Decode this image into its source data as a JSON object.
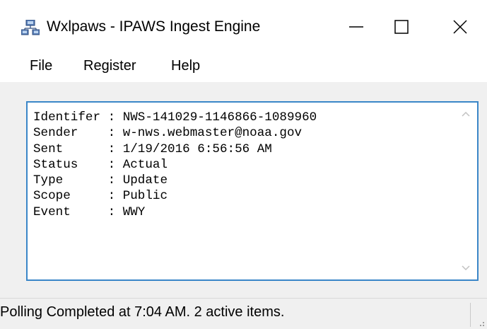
{
  "window": {
    "title": "Wxlpaws - IPAWS Ingest Engine",
    "app_icon": "network-computers-icon",
    "controls": [
      "minimize-icon",
      "maximize-icon",
      "close-icon"
    ]
  },
  "menu": {
    "items": [
      {
        "label": "File"
      },
      {
        "label": "Register"
      },
      {
        "label": "Help"
      }
    ]
  },
  "message": {
    "lines": [
      "Identifer : NWS-141029-1146866-1089960",
      "Sender    : w-nws.webmaster@noaa.gov",
      "Sent      : 1/19/2016 6:56:56 AM",
      "Status    : Actual",
      "Type      : Update",
      "Scope     : Public",
      "Event     : WWY"
    ]
  },
  "status": {
    "text": "Polling Completed at 7:04 AM. 2 active items."
  },
  "colors": {
    "accent_border": "#3a86c8",
    "window_bg": "#f0f0f0",
    "titlebar_bg": "#ffffff"
  }
}
